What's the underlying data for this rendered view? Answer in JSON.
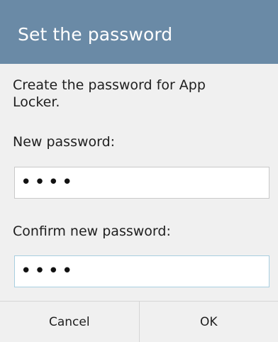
{
  "dialog": {
    "title": "Set the password",
    "message": "Create the password for App Locker.",
    "new_password": {
      "label": "New password:",
      "value": "••••"
    },
    "confirm_password": {
      "label": "Confirm new password:",
      "value": "••••"
    },
    "buttons": {
      "cancel": "Cancel",
      "ok": "OK"
    }
  },
  "colors": {
    "title_bar": "#6a8aa6",
    "dialog_background": "#f0f0f0",
    "field_focus_border": "#a8cfe0"
  }
}
